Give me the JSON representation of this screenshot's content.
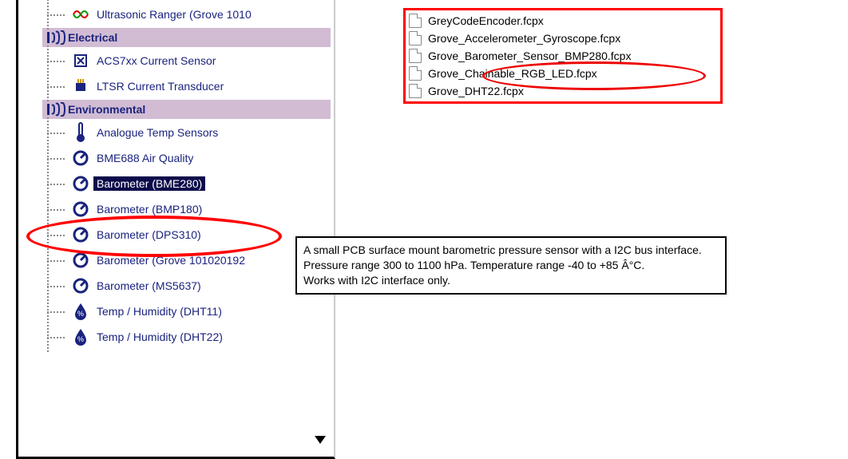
{
  "tree": {
    "top_partial_item": "Ultrasonic Ranger (Grove 1010",
    "categories": [
      {
        "name": "Electrical",
        "items": [
          {
            "label": "ACS7xx Current Sensor",
            "icon": "x-sensor"
          },
          {
            "label": "LTSR Current Transducer",
            "icon": "transducer"
          }
        ]
      },
      {
        "name": "Environmental",
        "items": [
          {
            "label": "Analogue Temp Sensors",
            "icon": "thermometer"
          },
          {
            "label": "BME688 Air Quality",
            "icon": "gauge"
          },
          {
            "label": "Barometer (BME280)",
            "icon": "gauge",
            "selected": true
          },
          {
            "label": "Barometer (BMP180)",
            "icon": "gauge"
          },
          {
            "label": "Barometer (DPS310)",
            "icon": "gauge"
          },
          {
            "label": "Barometer (Grove 101020192",
            "icon": "gauge"
          },
          {
            "label": "Barometer (MS5637)",
            "icon": "gauge"
          },
          {
            "label": "Temp / Humidity (DHT11)",
            "icon": "humidity"
          },
          {
            "label": "Temp / Humidity (DHT22)",
            "icon": "humidity"
          }
        ]
      }
    ]
  },
  "files": {
    "partial": "GreyCodeEncoder.fcpx",
    "items": [
      "Grove_Accelerometer_Gyroscope.fcpx",
      "Grove_Barometer_Sensor_BMP280.fcpx",
      "Grove_Chainable_RGB_LED.fcpx",
      "Grove_DHT22.fcpx"
    ]
  },
  "tooltip": {
    "line1": "A small PCB surface mount barometric pressure sensor with a I2C bus interface.",
    "line2": "Pressure range 300 to 1100 hPa. Temperature range -40 to +85 Â°C.",
    "line3": "Works with I2C interface only."
  },
  "colors": {
    "highlight_border": "#ff0000",
    "category_bg": "#d1bcd4",
    "text": "#1a237e",
    "selected_bg": "#0b0b4b"
  }
}
